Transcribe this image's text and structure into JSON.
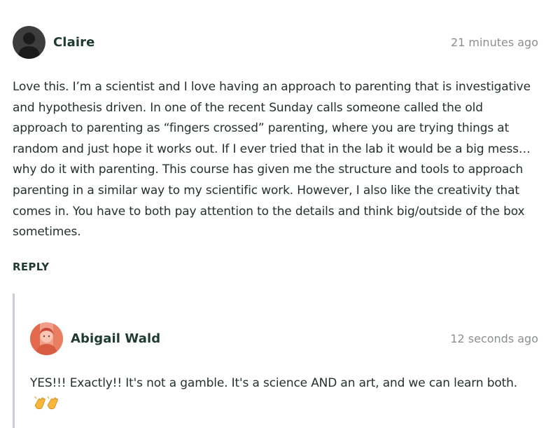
{
  "comments": [
    {
      "author": "Claire",
      "time": "21 minutes ago",
      "avatar_icon": "default-user-avatar-icon",
      "text": "Love this. I’m a scientist and I love having an approach to parenting that is investigative and hypothesis driven. In one of the recent Sunday calls someone called the old approach to parenting as “fingers crossed” parenting, where you are trying things at random and just hope it works out. If I ever tried that in the lab it would be a big mess… why do it with parenting. This course has given me the structure and tools to approach parenting in a similar way to my scientific work. However, I also like the creativity that comes in. You have to both pay attention to the details and think big/outside of the box sometimes.",
      "reply_label": "REPLY"
    }
  ],
  "replies": [
    {
      "author": "Abigail Wald",
      "time": "12 seconds ago",
      "avatar_icon": "user-photo-avatar-icon",
      "text": "YES!!! Exactly!! It's not a gamble. It's a science AND an art, and we can learn both.",
      "emoji_icon": "clapping-hands-icon"
    }
  ],
  "colors": {
    "author": "#1e3a33",
    "text": "#24312d",
    "time": "#8a8f8d",
    "thread_line": "#c9cedb",
    "avatar_default": "#3b3b3b",
    "avatar_photo": "#e8735a"
  }
}
